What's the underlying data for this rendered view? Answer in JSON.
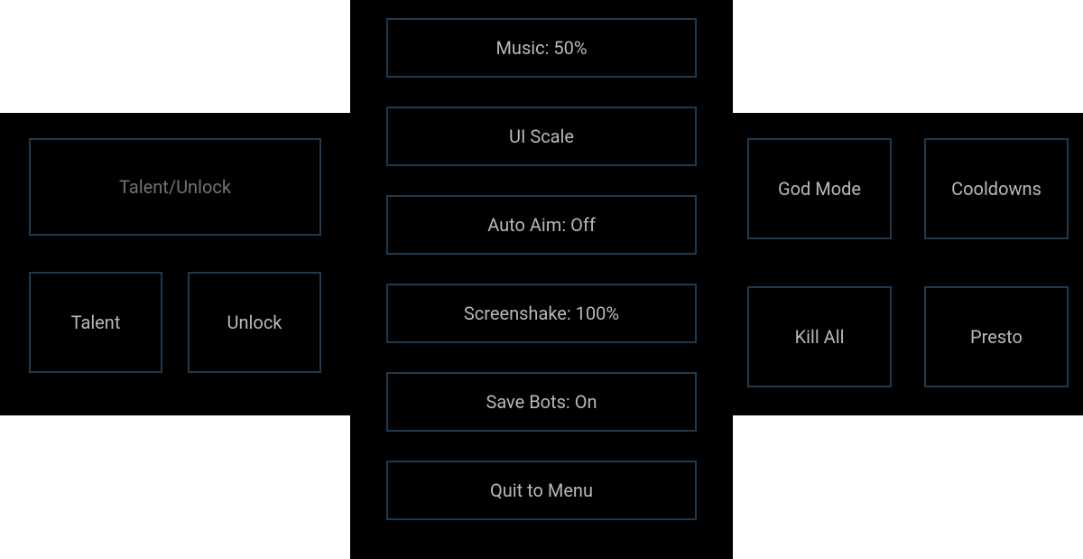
{
  "left": {
    "talentUnlock": "Talent/Unlock",
    "talent": "Talent",
    "unlock": "Unlock"
  },
  "center": {
    "music": "Music: 50%",
    "uiScale": "UI Scale",
    "autoAim": "Auto Aim: Off",
    "screenshake": "Screenshake: 100%",
    "saveBots": "Save Bots: On",
    "quit": "Quit to Menu"
  },
  "right": {
    "godMode": "God Mode",
    "cooldowns": "Cooldowns",
    "killAll": "Kill All",
    "presto": "Presto"
  }
}
